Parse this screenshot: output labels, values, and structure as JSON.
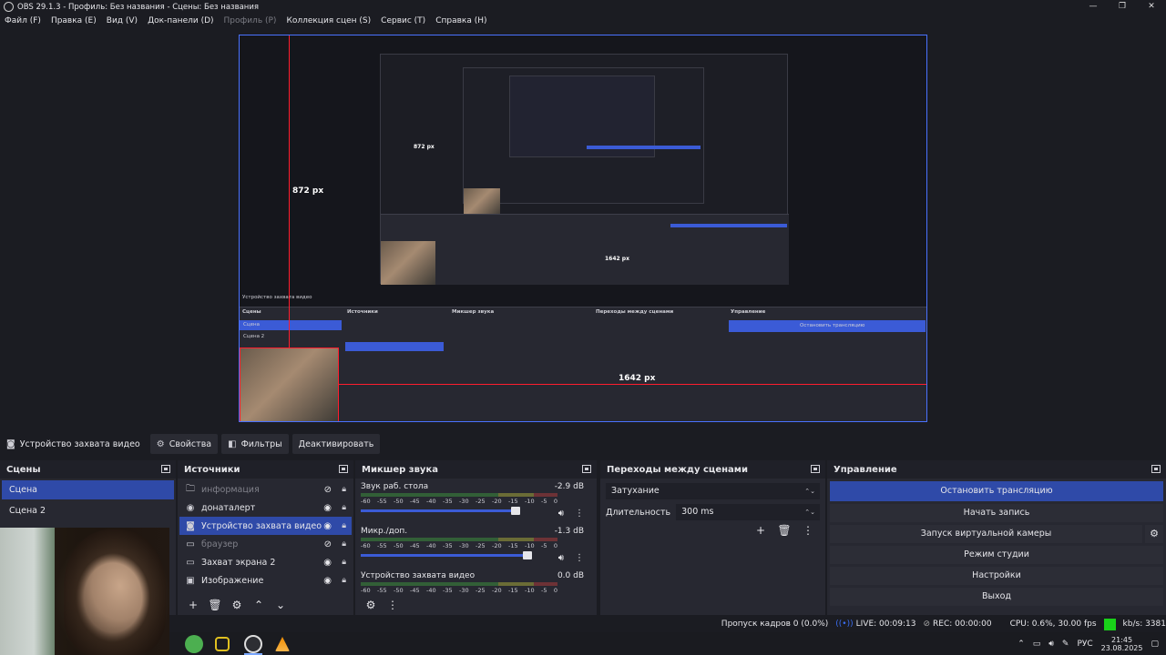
{
  "window": {
    "title": "OBS 29.1.3 - Профиль: Без названия - Сцены: Без названия",
    "controls": [
      "—",
      "❐",
      "✕"
    ]
  },
  "menu": {
    "items": [
      {
        "label": "Файл (F)",
        "disabled": false
      },
      {
        "label": "Правка (E)",
        "disabled": false
      },
      {
        "label": "Вид (V)",
        "disabled": false
      },
      {
        "label": "Док-панели (D)",
        "disabled": false
      },
      {
        "label": "Профиль (P)",
        "disabled": true
      },
      {
        "label": "Коллекция сцен (S)",
        "disabled": false
      },
      {
        "label": "Сервис (T)",
        "disabled": false
      },
      {
        "label": "Справка (H)",
        "disabled": false
      }
    ]
  },
  "preview": {
    "measure_vertical": "872 px",
    "measure_horizontal": "1642 px",
    "nested_measure_vertical": "872 px",
    "nested_measure_horizontal": "1642 px",
    "accent": "#4a72ff",
    "guide_color": "#ff1d2d"
  },
  "source_toolbar": {
    "source_name": "Устройство захвата видео",
    "properties": "Свойства",
    "filters": "Фильтры",
    "deactivate": "Деактивировать"
  },
  "scenes": {
    "title": "Сцены",
    "items": [
      {
        "label": "Сцена",
        "active": true
      },
      {
        "label": "Сцена 2",
        "active": false
      }
    ]
  },
  "sources": {
    "title": "Источники",
    "items": [
      {
        "label": "информация",
        "icon": "▸🗀",
        "visible": false,
        "active": false
      },
      {
        "label": "донаталерт",
        "icon": "◉",
        "visible": true,
        "active": false
      },
      {
        "label": "Устройство захвата видео",
        "icon": "◎",
        "visible": true,
        "active": true
      },
      {
        "label": "браузер",
        "icon": "▭",
        "visible": false,
        "active": false
      },
      {
        "label": "Захват экрана 2",
        "icon": "▭",
        "visible": true,
        "active": false
      },
      {
        "label": "Изображение",
        "icon": "▣",
        "visible": true,
        "active": false
      }
    ],
    "tools": [
      "+",
      "🗑",
      "⚙",
      "⌃",
      "⌄"
    ]
  },
  "mixer": {
    "title": "Микшер звука",
    "scale": [
      "-60",
      "-55",
      "-50",
      "-45",
      "-40",
      "-35",
      "-30",
      "-25",
      "-20",
      "-15",
      "-10",
      "-5",
      "0"
    ],
    "channels": [
      {
        "name": "Звук раб. стола",
        "db": "-2.9 dB"
      },
      {
        "name": "Микр./доп.",
        "db": "-1.3 dB"
      },
      {
        "name": "Устройство захвата видео",
        "db": "0.0 dB"
      }
    ]
  },
  "transitions": {
    "title": "Переходы между сценами",
    "selected": "Затухание",
    "duration_label": "Длительность",
    "duration_value": "300 ms"
  },
  "controls": {
    "title": "Управление",
    "stop_stream": "Остановить трансляцию",
    "start_record": "Начать запись",
    "virtual_cam": "Запуск виртуальной камеры",
    "studio_mode": "Режим студии",
    "settings": "Настройки",
    "exit": "Выход"
  },
  "status": {
    "dropped": "Пропуск кадров 0 (0.0%)",
    "live": "LIVE: 00:09:13",
    "rec": "REC: 00:00:00",
    "cpu": "CPU: 0.6%, 30.00 fps",
    "kbs": "kb/s: 3381"
  },
  "taskbar": {
    "lang": "РУС",
    "time": "21:45",
    "date": "23.08.2025"
  }
}
